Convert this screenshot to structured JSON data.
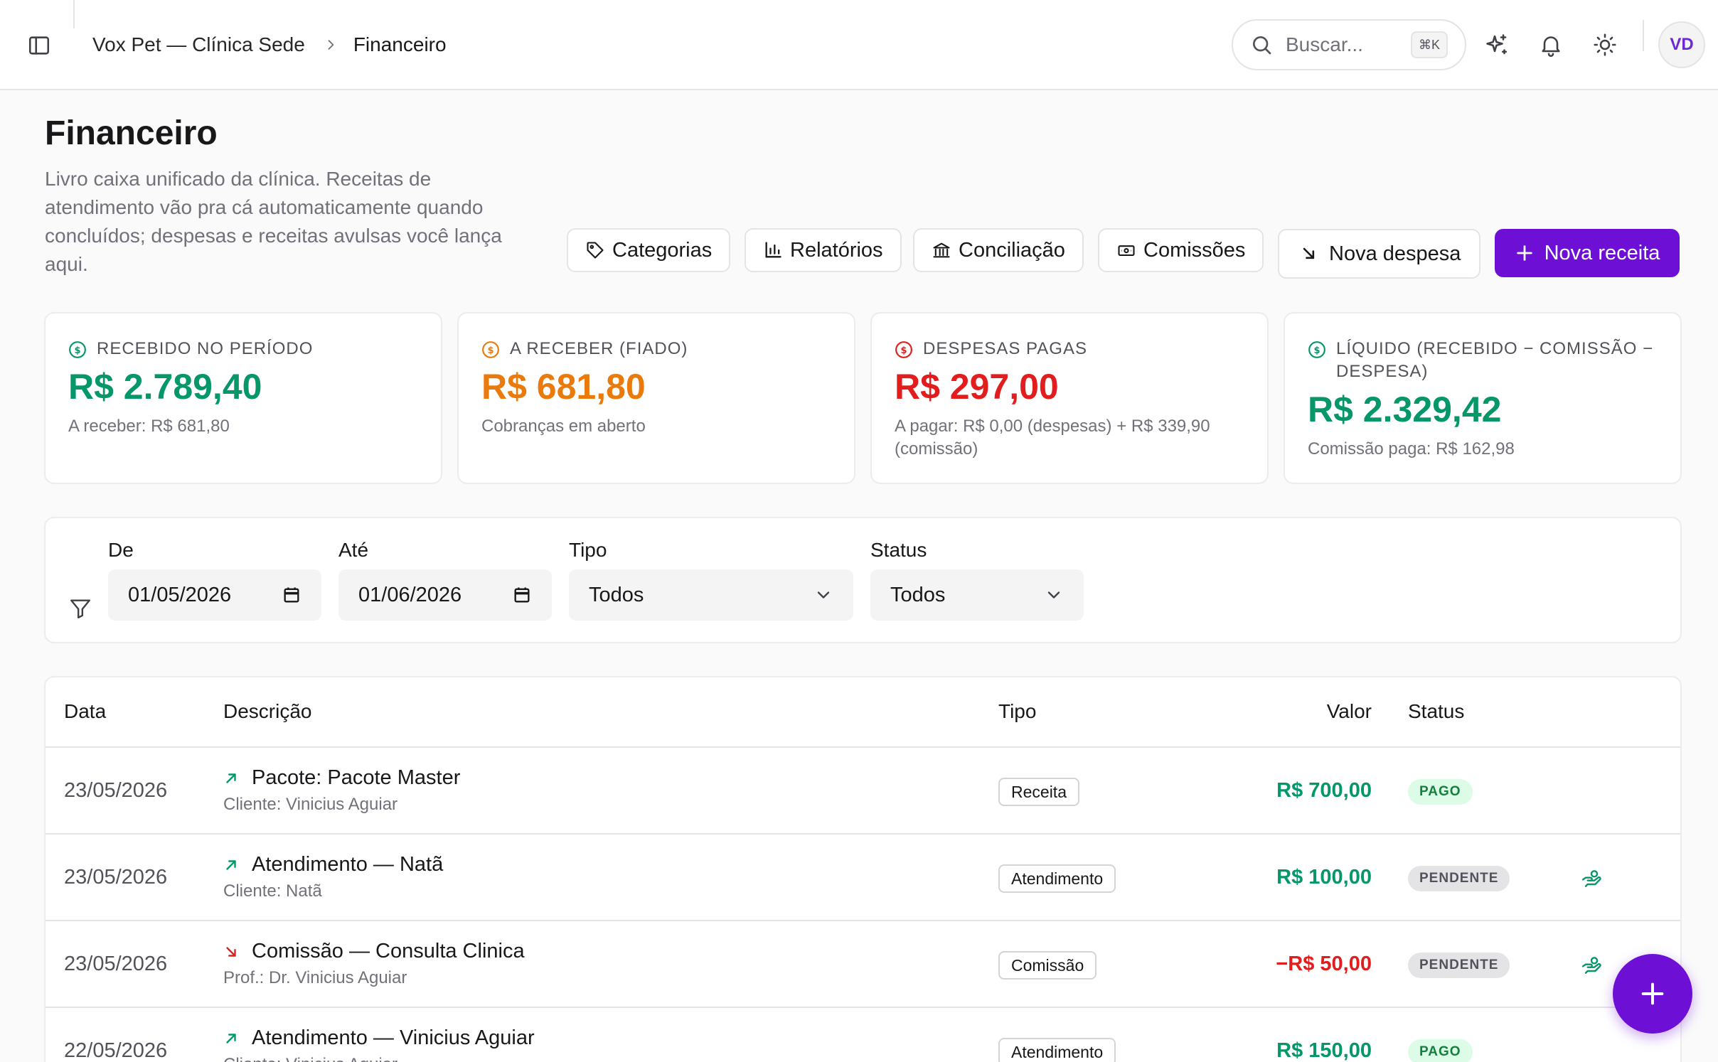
{
  "breadcrumb": {
    "clinic": "Vox Pet — Clínica Sede",
    "current": "Financeiro"
  },
  "search": {
    "placeholder": "Buscar...",
    "shortcut": "⌘K"
  },
  "user": {
    "initials": "VD"
  },
  "page": {
    "title": "Financeiro",
    "description": "Livro caixa unificado da clínica. Receitas de atendimento vão pra cá automaticamente quando concluídos; despesas e receitas avulsas você lança aqui."
  },
  "actions": {
    "categorias": "Categorias",
    "relatorios": "Relatórios",
    "conciliacao": "Conciliação",
    "comissoes": "Comissões",
    "nova_despesa": "Nova despesa",
    "nova_receita": "Nova receita"
  },
  "stats": [
    {
      "label": "RECEBIDO NO PERÍODO",
      "value": "R$ 2.789,40",
      "sub": "A receber: R$ 681,80",
      "color": "#059669"
    },
    {
      "label": "A RECEBER (FIADO)",
      "value": "R$ 681,80",
      "sub": "Cobranças em aberto",
      "color": "#ea7a0c"
    },
    {
      "label": "DESPESAS PAGAS",
      "value": "R$ 297,00",
      "sub": "A pagar: R$ 0,00 (despesas) + R$ 339,90 (comissão)",
      "color": "#e11d1d"
    },
    {
      "label": "LÍQUIDO (RECEBIDO − COMISSÃO − DESPESA)",
      "value": "R$ 2.329,42",
      "sub": "Comissão paga: R$ 162,98",
      "color": "#059669"
    }
  ],
  "filters": {
    "de": {
      "label": "De",
      "value": "01/05/2026"
    },
    "ate": {
      "label": "Até",
      "value": "01/06/2026"
    },
    "tipo": {
      "label": "Tipo",
      "value": "Todos"
    },
    "status": {
      "label": "Status",
      "value": "Todos"
    }
  },
  "table": {
    "headers": {
      "data": "Data",
      "descricao": "Descrição",
      "tipo": "Tipo",
      "valor": "Valor",
      "status": "Status"
    },
    "rows": [
      {
        "date": "23/05/2026",
        "direction": "in",
        "title": "Pacote: Pacote Master",
        "sub": "Cliente: Vinicius Aguiar",
        "type": "Receita",
        "value": "R$ 700,00",
        "status": "PAGO"
      },
      {
        "date": "23/05/2026",
        "direction": "in",
        "title": "Atendimento — Natã",
        "sub": "Cliente: Natã",
        "type": "Atendimento",
        "value": "R$ 100,00",
        "status": "PENDENTE"
      },
      {
        "date": "23/05/2026",
        "direction": "out",
        "title": "Comissão — Consulta Clinica",
        "sub": "Prof.: Dr. Vinicius Aguiar",
        "type": "Comissão",
        "value": "−R$ 50,00",
        "status": "PENDENTE"
      },
      {
        "date": "22/05/2026",
        "direction": "in",
        "title": "Atendimento — Vinicius Aguiar",
        "sub": "Cliente: Vinicius Aguiar",
        "type": "Atendimento",
        "value": "R$ 150,00",
        "status": "PAGO"
      }
    ]
  },
  "colors": {
    "accent": "#6d0fd4",
    "income": "#059669",
    "expense": "#e11d1d",
    "pending": "#ea7a0c"
  }
}
